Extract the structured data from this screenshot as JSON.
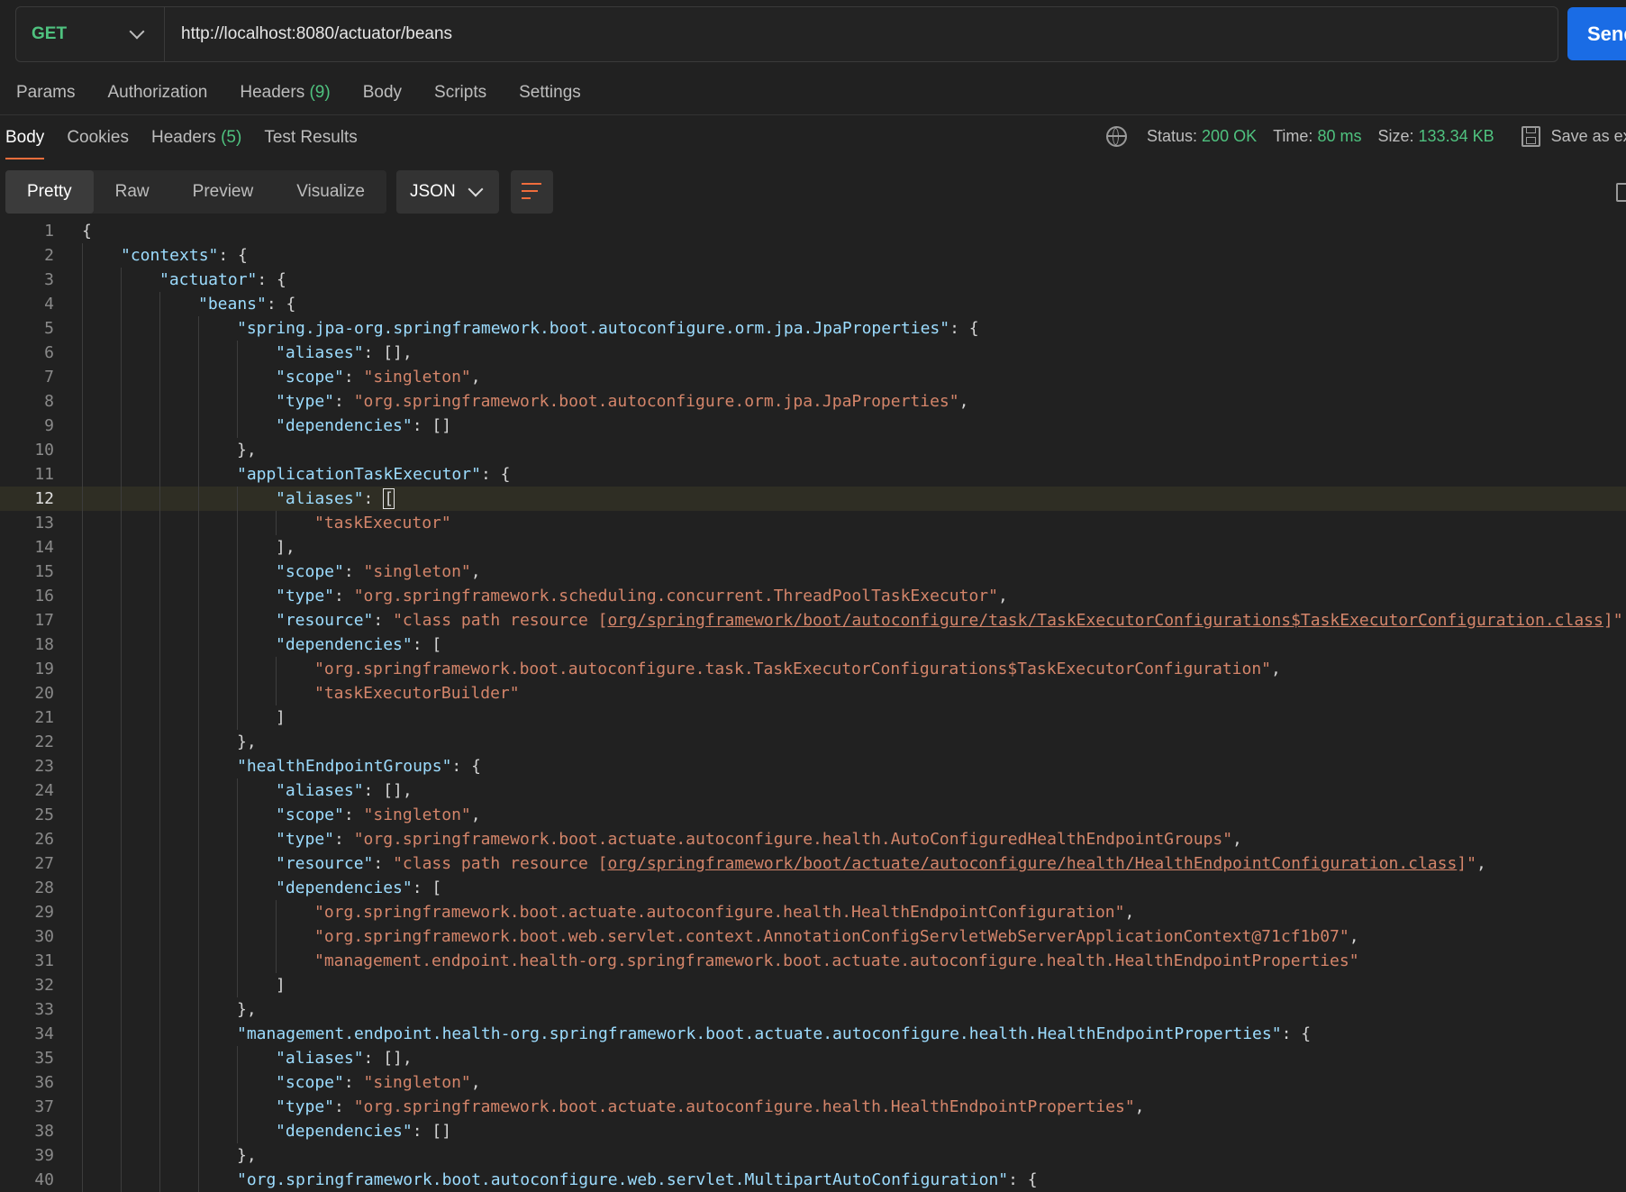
{
  "request": {
    "method": "GET",
    "url": "http://localhost:8080/actuator/beans",
    "send_label": "Send"
  },
  "request_tabs": [
    {
      "label": "Params",
      "count": ""
    },
    {
      "label": "Authorization",
      "count": ""
    },
    {
      "label": "Headers",
      "count": "(9)"
    },
    {
      "label": "Body",
      "count": ""
    },
    {
      "label": "Scripts",
      "count": ""
    },
    {
      "label": "Settings",
      "count": ""
    }
  ],
  "response_tabs": [
    {
      "label": "Body",
      "count": "",
      "active": true
    },
    {
      "label": "Cookies",
      "count": "",
      "active": false
    },
    {
      "label": "Headers",
      "count": "(5)",
      "active": false
    },
    {
      "label": "Test Results",
      "count": "",
      "active": false
    }
  ],
  "status": {
    "status_label": "Status:",
    "status_value": "200 OK",
    "time_label": "Time:",
    "time_value": "80 ms",
    "size_label": "Size:",
    "size_value": "133.34 KB",
    "save_label": "Save as example"
  },
  "view_tabs": [
    {
      "label": "Pretty",
      "active": true
    },
    {
      "label": "Raw",
      "active": false
    },
    {
      "label": "Preview",
      "active": false
    },
    {
      "label": "Visualize",
      "active": false
    }
  ],
  "format": "JSON",
  "code_lines": [
    {
      "n": 1,
      "d": 0,
      "t": [
        [
          "p",
          "{"
        ]
      ]
    },
    {
      "n": 2,
      "d": 1,
      "t": [
        [
          "k",
          "\"contexts\""
        ],
        [
          "p",
          ": {"
        ]
      ]
    },
    {
      "n": 3,
      "d": 2,
      "t": [
        [
          "k",
          "\"actuator\""
        ],
        [
          "p",
          ": {"
        ]
      ]
    },
    {
      "n": 4,
      "d": 3,
      "t": [
        [
          "k",
          "\"beans\""
        ],
        [
          "p",
          ": {"
        ]
      ]
    },
    {
      "n": 5,
      "d": 4,
      "t": [
        [
          "k",
          "\"spring.jpa-org.springframework.boot.autoconfigure.orm.jpa.JpaProperties\""
        ],
        [
          "p",
          ": {"
        ]
      ]
    },
    {
      "n": 6,
      "d": 5,
      "t": [
        [
          "k",
          "\"aliases\""
        ],
        [
          "p",
          ": [],"
        ]
      ]
    },
    {
      "n": 7,
      "d": 5,
      "t": [
        [
          "k",
          "\"scope\""
        ],
        [
          "p",
          ": "
        ],
        [
          "s",
          "\"singleton\""
        ],
        [
          "p",
          ","
        ]
      ]
    },
    {
      "n": 8,
      "d": 5,
      "t": [
        [
          "k",
          "\"type\""
        ],
        [
          "p",
          ": "
        ],
        [
          "s",
          "\"org.springframework.boot.autoconfigure.orm.jpa.JpaProperties\""
        ],
        [
          "p",
          ","
        ]
      ]
    },
    {
      "n": 9,
      "d": 5,
      "t": [
        [
          "k",
          "\"dependencies\""
        ],
        [
          "p",
          ": []"
        ]
      ]
    },
    {
      "n": 10,
      "d": 4,
      "t": [
        [
          "p",
          "},"
        ]
      ]
    },
    {
      "n": 11,
      "d": 4,
      "t": [
        [
          "k",
          "\"applicationTaskExecutor\""
        ],
        [
          "p",
          ": {"
        ]
      ]
    },
    {
      "n": 12,
      "d": 5,
      "hl": true,
      "t": [
        [
          "k",
          "\"aliases\""
        ],
        [
          "p",
          ": "
        ],
        [
          "c",
          "["
        ]
      ]
    },
    {
      "n": 13,
      "d": 6,
      "t": [
        [
          "s",
          "\"taskExecutor\""
        ]
      ]
    },
    {
      "n": 14,
      "d": 5,
      "t": [
        [
          "p",
          "],"
        ]
      ]
    },
    {
      "n": 15,
      "d": 5,
      "t": [
        [
          "k",
          "\"scope\""
        ],
        [
          "p",
          ": "
        ],
        [
          "s",
          "\"singleton\""
        ],
        [
          "p",
          ","
        ]
      ]
    },
    {
      "n": 16,
      "d": 5,
      "t": [
        [
          "k",
          "\"type\""
        ],
        [
          "p",
          ": "
        ],
        [
          "s",
          "\"org.springframework.scheduling.concurrent.ThreadPoolTaskExecutor\""
        ],
        [
          "p",
          ","
        ]
      ]
    },
    {
      "n": 17,
      "d": 5,
      "t": [
        [
          "k",
          "\"resource\""
        ],
        [
          "p",
          ": "
        ],
        [
          "s",
          "\"class path resource ["
        ],
        [
          "su",
          "org/springframework/boot/autoconfigure/task/TaskExecutorConfigurations$TaskExecutorConfiguration.class"
        ],
        [
          "s",
          "]\""
        ],
        [
          "p",
          ","
        ]
      ]
    },
    {
      "n": 18,
      "d": 5,
      "t": [
        [
          "k",
          "\"dependencies\""
        ],
        [
          "p",
          ": ["
        ]
      ]
    },
    {
      "n": 19,
      "d": 6,
      "t": [
        [
          "s",
          "\"org.springframework.boot.autoconfigure.task.TaskExecutorConfigurations$TaskExecutorConfiguration\""
        ],
        [
          "p",
          ","
        ]
      ]
    },
    {
      "n": 20,
      "d": 6,
      "t": [
        [
          "s",
          "\"taskExecutorBuilder\""
        ]
      ]
    },
    {
      "n": 21,
      "d": 5,
      "t": [
        [
          "p",
          "]"
        ]
      ]
    },
    {
      "n": 22,
      "d": 4,
      "t": [
        [
          "p",
          "},"
        ]
      ]
    },
    {
      "n": 23,
      "d": 4,
      "t": [
        [
          "k",
          "\"healthEndpointGroups\""
        ],
        [
          "p",
          ": {"
        ]
      ]
    },
    {
      "n": 24,
      "d": 5,
      "t": [
        [
          "k",
          "\"aliases\""
        ],
        [
          "p",
          ": [],"
        ]
      ]
    },
    {
      "n": 25,
      "d": 5,
      "t": [
        [
          "k",
          "\"scope\""
        ],
        [
          "p",
          ": "
        ],
        [
          "s",
          "\"singleton\""
        ],
        [
          "p",
          ","
        ]
      ]
    },
    {
      "n": 26,
      "d": 5,
      "t": [
        [
          "k",
          "\"type\""
        ],
        [
          "p",
          ": "
        ],
        [
          "s",
          "\"org.springframework.boot.actuate.autoconfigure.health.AutoConfiguredHealthEndpointGroups\""
        ],
        [
          "p",
          ","
        ]
      ]
    },
    {
      "n": 27,
      "d": 5,
      "t": [
        [
          "k",
          "\"resource\""
        ],
        [
          "p",
          ": "
        ],
        [
          "s",
          "\"class path resource ["
        ],
        [
          "su",
          "org/springframework/boot/actuate/autoconfigure/health/HealthEndpointConfiguration.class"
        ],
        [
          "s",
          "]\""
        ],
        [
          "p",
          ","
        ]
      ]
    },
    {
      "n": 28,
      "d": 5,
      "t": [
        [
          "k",
          "\"dependencies\""
        ],
        [
          "p",
          ": ["
        ]
      ]
    },
    {
      "n": 29,
      "d": 6,
      "t": [
        [
          "s",
          "\"org.springframework.boot.actuate.autoconfigure.health.HealthEndpointConfiguration\""
        ],
        [
          "p",
          ","
        ]
      ]
    },
    {
      "n": 30,
      "d": 6,
      "t": [
        [
          "s",
          "\"org.springframework.boot.web.servlet.context.AnnotationConfigServletWebServerApplicationContext@71cf1b07\""
        ],
        [
          "p",
          ","
        ]
      ]
    },
    {
      "n": 31,
      "d": 6,
      "t": [
        [
          "s",
          "\"management.endpoint.health-org.springframework.boot.actuate.autoconfigure.health.HealthEndpointProperties\""
        ]
      ]
    },
    {
      "n": 32,
      "d": 5,
      "t": [
        [
          "p",
          "]"
        ]
      ]
    },
    {
      "n": 33,
      "d": 4,
      "t": [
        [
          "p",
          "},"
        ]
      ]
    },
    {
      "n": 34,
      "d": 4,
      "t": [
        [
          "k",
          "\"management.endpoint.health-org.springframework.boot.actuate.autoconfigure.health.HealthEndpointProperties\""
        ],
        [
          "p",
          ": {"
        ]
      ]
    },
    {
      "n": 35,
      "d": 5,
      "t": [
        [
          "k",
          "\"aliases\""
        ],
        [
          "p",
          ": [],"
        ]
      ]
    },
    {
      "n": 36,
      "d": 5,
      "t": [
        [
          "k",
          "\"scope\""
        ],
        [
          "p",
          ": "
        ],
        [
          "s",
          "\"singleton\""
        ],
        [
          "p",
          ","
        ]
      ]
    },
    {
      "n": 37,
      "d": 5,
      "t": [
        [
          "k",
          "\"type\""
        ],
        [
          "p",
          ": "
        ],
        [
          "s",
          "\"org.springframework.boot.actuate.autoconfigure.health.HealthEndpointProperties\""
        ],
        [
          "p",
          ","
        ]
      ]
    },
    {
      "n": 38,
      "d": 5,
      "t": [
        [
          "k",
          "\"dependencies\""
        ],
        [
          "p",
          ": []"
        ]
      ]
    },
    {
      "n": 39,
      "d": 4,
      "t": [
        [
          "p",
          "},"
        ]
      ]
    },
    {
      "n": 40,
      "d": 4,
      "t": [
        [
          "k",
          "\"org.springframework.boot.autoconfigure.web.servlet.MultipartAutoConfiguration\""
        ],
        [
          "p",
          ": {"
        ]
      ]
    }
  ]
}
